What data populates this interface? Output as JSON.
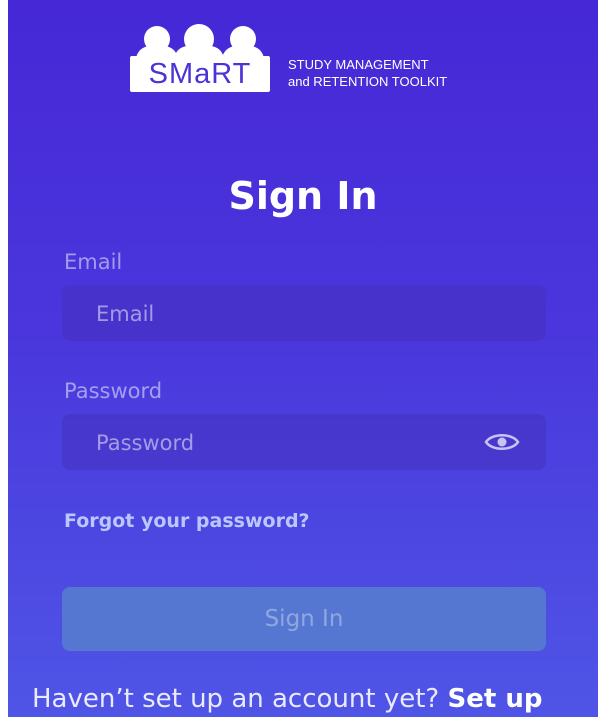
{
  "brand": {
    "logo_text": "SMaRT",
    "tagline_line1": "STUDY MANAGEMENT",
    "tagline_line2": "and RETENTION TOOLKIT"
  },
  "page": {
    "title": "Sign In"
  },
  "form": {
    "email_label": "Email",
    "email_placeholder": "Email",
    "password_label": "Password",
    "password_placeholder": "Password",
    "forgot_link": "Forgot your password?",
    "submit_label": "Sign In"
  },
  "footer": {
    "prompt": "Haven’t set up an account yet?",
    "setup_link": "Set up"
  },
  "icons": {
    "password_toggle": "eye-icon"
  }
}
